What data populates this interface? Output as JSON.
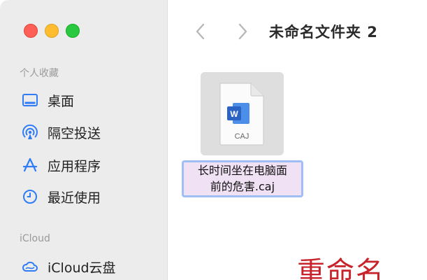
{
  "sidebar": {
    "favorites_title": "个人收藏",
    "favorites": [
      {
        "label": "桌面",
        "icon": "desktop-icon"
      },
      {
        "label": "隔空投送",
        "icon": "airdrop-icon"
      },
      {
        "label": "应用程序",
        "icon": "applications-icon"
      },
      {
        "label": "最近使用",
        "icon": "clock-icon"
      }
    ],
    "icloud_title": "iCloud",
    "icloud": [
      {
        "label": "iCloud云盘",
        "icon": "cloud-icon"
      }
    ]
  },
  "toolbar": {
    "back_icon": "chevron-left-icon",
    "forward_icon": "chevron-right-icon",
    "title": "未命名文件夹 2"
  },
  "file": {
    "extension": "CAJ",
    "icon": "word-document-icon",
    "name": "长时间坐在电脑面\n前的危害.caj"
  },
  "annotation": {
    "text": "重命名"
  },
  "colors": {
    "accent_red": "#c8232a",
    "selection_border": "#9fbff4",
    "sidebar_icon": "#2f7cf6",
    "word_blue": "#2b63c4"
  }
}
